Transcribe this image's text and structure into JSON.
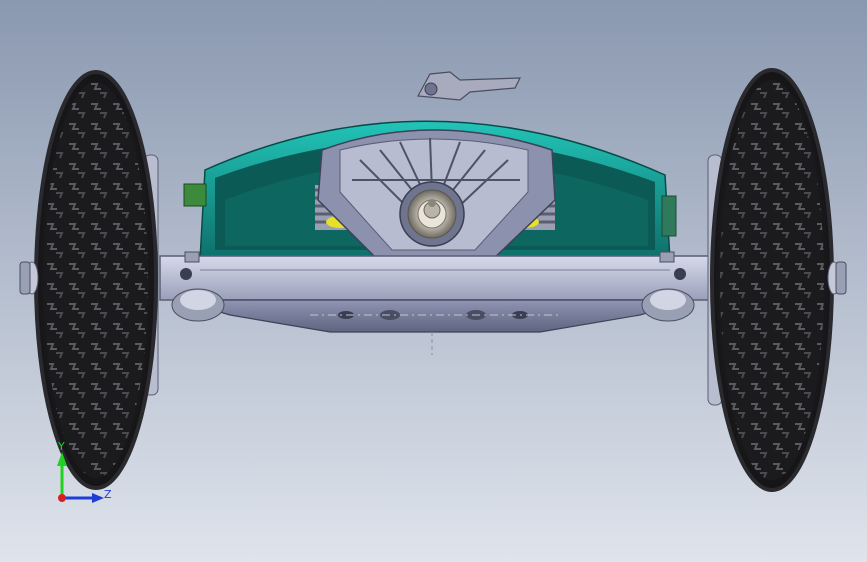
{
  "viewport": {
    "background_top": "#8a98b0",
    "background_bottom": "#dfe4ec"
  },
  "model": {
    "deck_color": "#1aa89f",
    "deck_dark": "#0b5a55",
    "frame_color": "#c3c8dc",
    "frame_shadow": "#6e7490",
    "tire_color": "#1e1e20",
    "spring_color": "#a9aebd",
    "bushing_color": "#e6e02a"
  },
  "triad": {
    "y_label": "Y",
    "z_label": "Z",
    "y_color": "#1fd21f",
    "z_color": "#1f3cd6",
    "origin_color": "#d61f1f"
  }
}
